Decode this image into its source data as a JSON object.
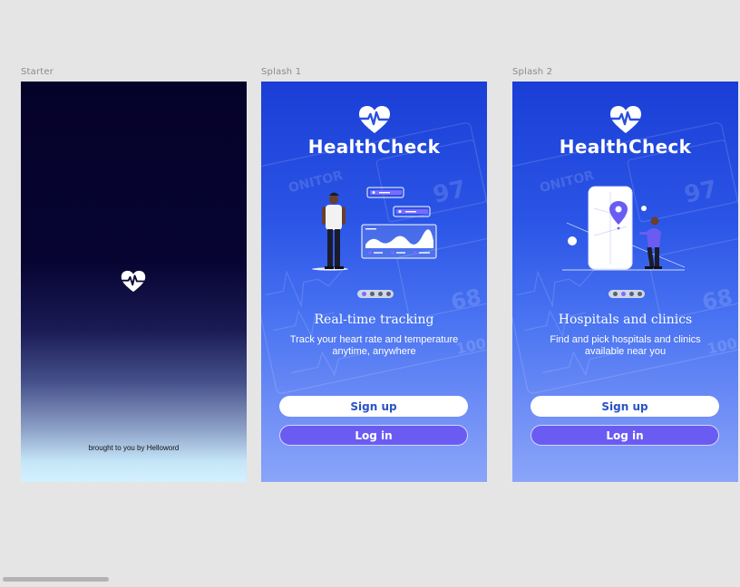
{
  "frames": {
    "starter": {
      "label": "Starter",
      "credit": "brought to you by Helloword"
    },
    "splash1": {
      "label": "Splash 1",
      "app_name": "HealthCheck",
      "headline": "Real-time tracking",
      "subtext_line1": "Track your heart rate and temperature",
      "subtext_line2": "anytime, anywhere",
      "signup_label": "Sign up",
      "login_label": "Log in",
      "active_page": 1
    },
    "splash2": {
      "label": "Splash 2",
      "app_name": "HealthCheck",
      "headline": "Hospitals and clinics",
      "subtext_line1": "Find and pick hospitals and clinics",
      "subtext_line2": "available near you",
      "signup_label": "Sign up",
      "login_label": "Log in",
      "active_page": 2
    }
  },
  "colors": {
    "canvas": "#e5e5e5",
    "starter_top": "#05022a",
    "starter_bottom": "#d3f0ff",
    "splash_top": "#1a3ed6",
    "splash_bottom": "#8aa5f8",
    "login_button": "#6a5cf2",
    "signup_text": "#2852c8",
    "active_dot": "#7a6bff"
  },
  "icons": [
    "heart-pulse-logo-icon",
    "location-pin-icon"
  ]
}
